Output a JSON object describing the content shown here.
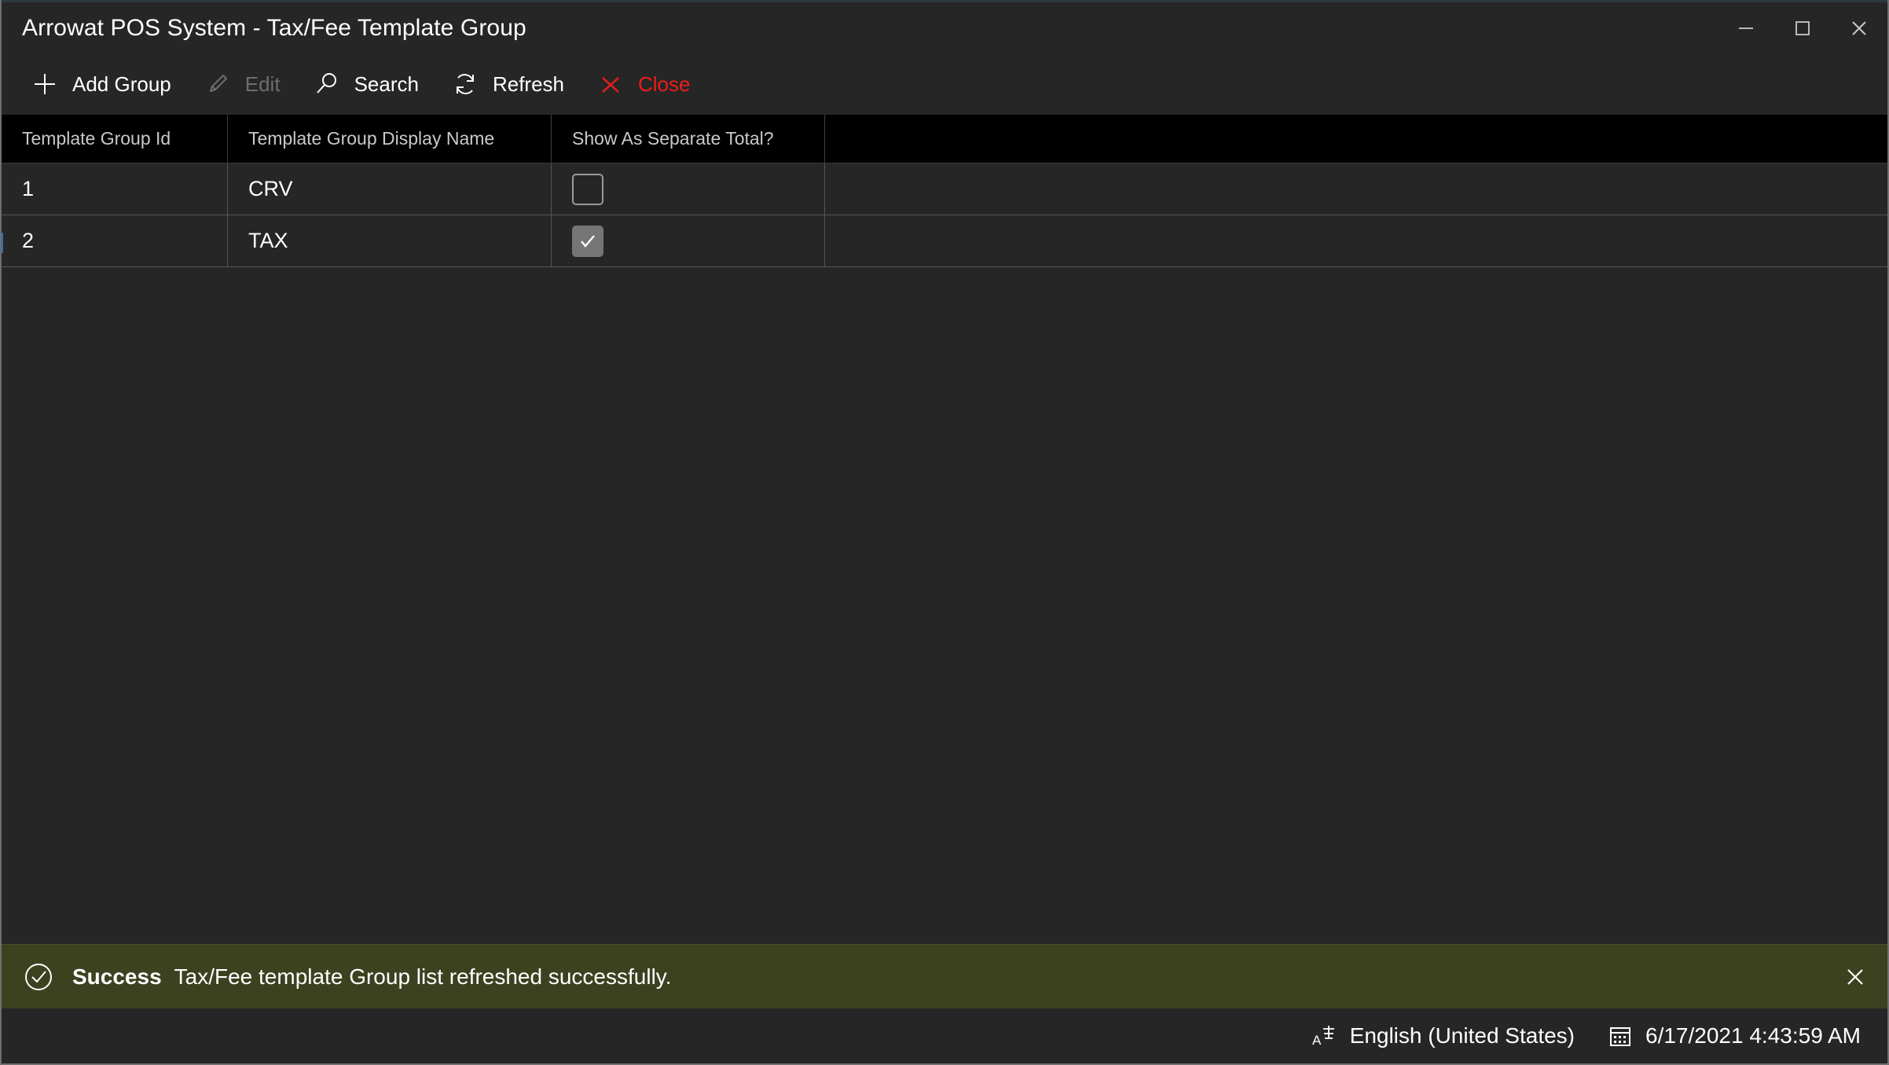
{
  "window": {
    "title": "Arrowat POS System - Tax/Fee Template Group",
    "controls": {
      "minimize": "minimize-icon",
      "maximize": "maximize-icon",
      "close": "close-icon"
    }
  },
  "toolbar": {
    "items": [
      {
        "label": "Add Group",
        "icon": "plus-icon",
        "state": "enabled"
      },
      {
        "label": "Edit",
        "icon": "pencil-icon",
        "state": "disabled"
      },
      {
        "label": "Search",
        "icon": "search-icon",
        "state": "enabled"
      },
      {
        "label": "Refresh",
        "icon": "refresh-icon",
        "state": "enabled"
      },
      {
        "label": "Close",
        "icon": "x-icon",
        "state": "danger"
      }
    ]
  },
  "grid": {
    "columns": [
      "Template Group Id",
      "Template Group Display Name",
      "Show As Separate Total?",
      ""
    ],
    "rows": [
      {
        "id": "1",
        "display_name": "CRV",
        "show_as_separate_total": false,
        "selected": false
      },
      {
        "id": "2",
        "display_name": "TAX",
        "show_as_separate_total": true,
        "selected": true
      }
    ]
  },
  "banner": {
    "icon": "check-circle-icon",
    "title": "Success",
    "message": "Tax/Fee template Group list refreshed successfully.",
    "close": "close-icon",
    "background": "#3c4220"
  },
  "statusbar": {
    "language_icon": "input-language-icon",
    "language": "English (United States)",
    "datetime_icon": "calendar-icon",
    "datetime": "6/17/2021 4:43:59 AM"
  },
  "colors": {
    "window_bg": "#262626",
    "header_bg": "#000000",
    "accent_danger": "#ef1b1b",
    "selection_marker": "#2f6fb5"
  }
}
